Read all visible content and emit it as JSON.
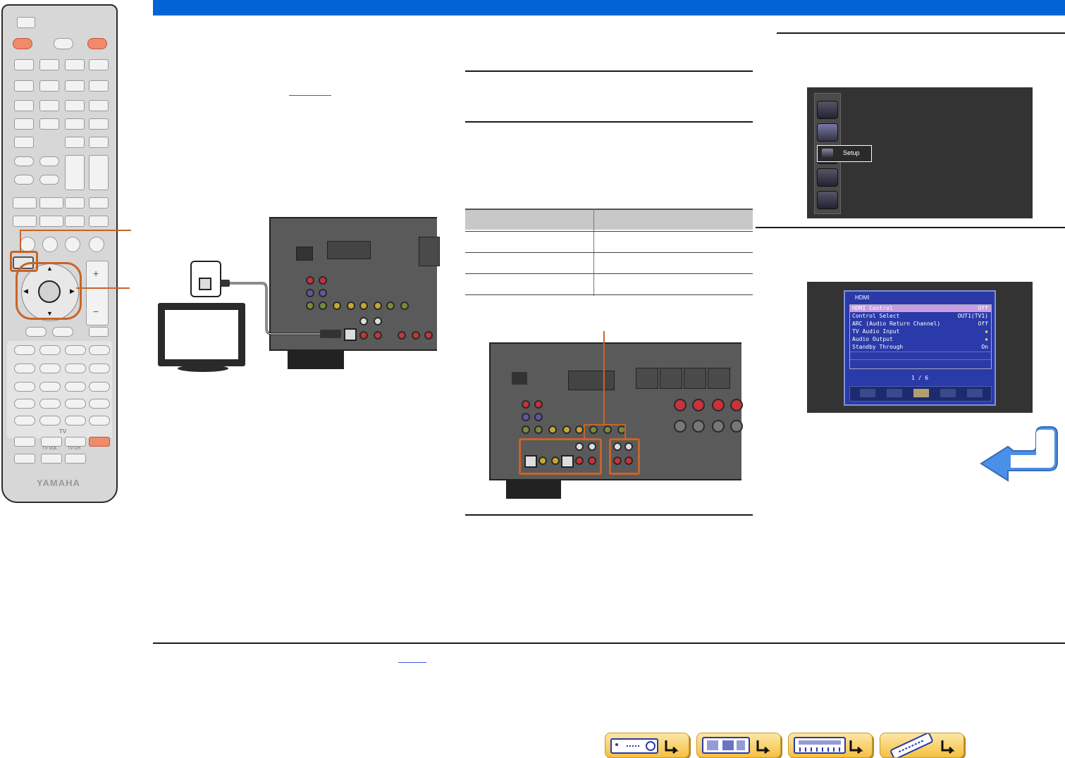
{
  "remote": {
    "brand": "YAMAHA",
    "tv_label": "TV",
    "tv_vol_label": "TV VOL",
    "tv_ch_label": "TV CH"
  },
  "colors": {
    "header_bar": "#0064d6",
    "callout": "#c8642a",
    "menu_bg": "#333333",
    "hdmi_window": "#2a3aa8",
    "hdmi_highlight": "#c89ee0",
    "return_arrow": "#4a90e8",
    "nav_button": "#f5c040"
  },
  "setup_menu": {
    "selected_label": "Setup"
  },
  "hdmi_menu": {
    "title": "HDMI",
    "rows": [
      {
        "label": "HDMI Control",
        "value": "Off"
      },
      {
        "label": "Control Select",
        "value": "OUT1(TV1)"
      },
      {
        "label": "ARC (Audio Return Channel)",
        "value": "Off"
      },
      {
        "label": "TV Audio Input",
        "value": "▪"
      },
      {
        "label": "Audio Output",
        "value": "▪"
      },
      {
        "label": "Standby Through",
        "value": "On"
      }
    ],
    "page": "1 / 6"
  },
  "icons": {
    "return": "return-arrow-icon",
    "nav": [
      "receiver-front-icon",
      "receiver-rear-icon",
      "rear-panel-icon",
      "remote-control-icon"
    ]
  }
}
